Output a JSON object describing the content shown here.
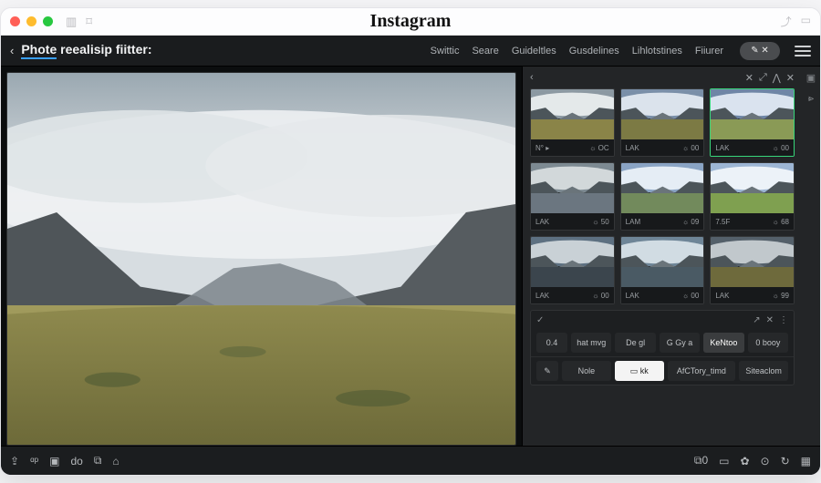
{
  "window": {
    "brand": "Instagram"
  },
  "header": {
    "back": "‹",
    "title_word1": "Phote",
    "title_rest": "reealisip fiitter:",
    "tabs": [
      "Swittic",
      "Seare",
      "Guideltles",
      "Gusdelines",
      "Lihlotstines",
      "Fiiurer"
    ]
  },
  "panel": {
    "head_back": "‹",
    "thumbs": [
      {
        "left": "N°  ▸",
        "right": "OC",
        "selected": false,
        "variant": 0
      },
      {
        "left": "LAK",
        "right": "00",
        "selected": false,
        "variant": 1
      },
      {
        "left": "LAK",
        "right": "00",
        "selected": true,
        "variant": 2
      },
      {
        "left": "LAK",
        "right": "50",
        "selected": false,
        "variant": 3
      },
      {
        "left": "LAM",
        "right": "09",
        "selected": false,
        "variant": 4
      },
      {
        "left": "7.5F",
        "right": "68",
        "selected": false,
        "variant": 5
      },
      {
        "left": "LAK",
        "right": "00",
        "selected": false,
        "variant": 6
      },
      {
        "left": "LAK",
        "right": "00",
        "selected": false,
        "variant": 7
      },
      {
        "left": "LAK",
        "right": "99",
        "selected": false,
        "variant": 8
      }
    ],
    "opt_row": {
      "value": "0.4",
      "chips": [
        "hat mvg",
        "De gl",
        "G Gy a",
        "KeNtoo",
        "0 booy"
      ],
      "active_index": 3
    },
    "action_row": {
      "chips": [
        "Nole",
        "kk",
        "AfCTory_timd",
        "Siteaclom"
      ],
      "inverted_index": 1
    }
  },
  "bottombar": {
    "left_icons": [
      "⇪",
      "ᵅᵖ",
      "▣",
      "do",
      "⧉",
      "⌂"
    ],
    "right_icons": [
      "⧉0",
      "▭",
      "✿",
      "⊙",
      "↻",
      "▦"
    ]
  }
}
